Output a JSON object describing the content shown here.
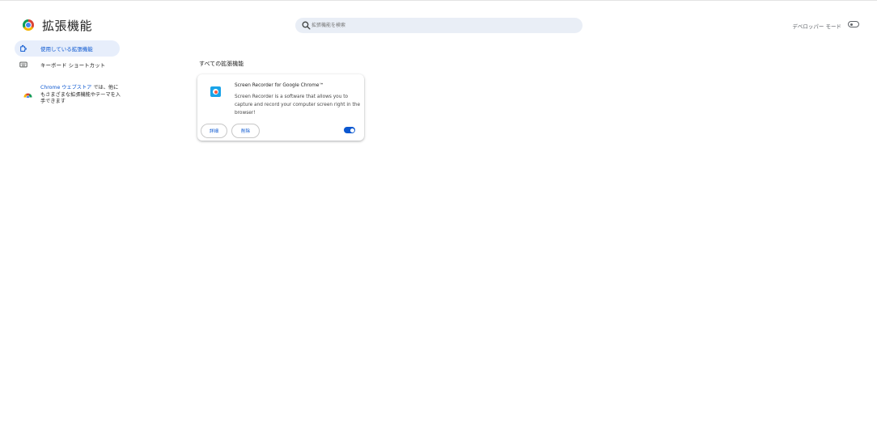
{
  "header": {
    "title": "拡張機能",
    "search_placeholder": "拡張機能を検索",
    "developer_mode_label": "デベロッパー モード",
    "developer_mode_on": false
  },
  "sidebar": {
    "items": [
      {
        "label": "使用している拡張機能",
        "icon": "puzzle-icon",
        "active": true
      },
      {
        "label": "キーボード ショートカット",
        "icon": "keyboard-icon",
        "active": false
      }
    ],
    "store_link": "Chrome ウェブストア",
    "store_text": " では、他にもさまざまな拡張機能やテーマを入手できます"
  },
  "main": {
    "section_title": "すべての拡張機能",
    "extensions": [
      {
        "name": "Screen Recorder for Google Chrome™",
        "description": "Screen Recorder is a software that allows you to capture and record your computer screen right in the browser!",
        "details_label": "詳細",
        "remove_label": "削除",
        "enabled": true
      }
    ]
  },
  "colors": {
    "accent": "#0b57d0",
    "active_nav_bg": "#e7eefb",
    "search_bg": "#e9eef6"
  }
}
